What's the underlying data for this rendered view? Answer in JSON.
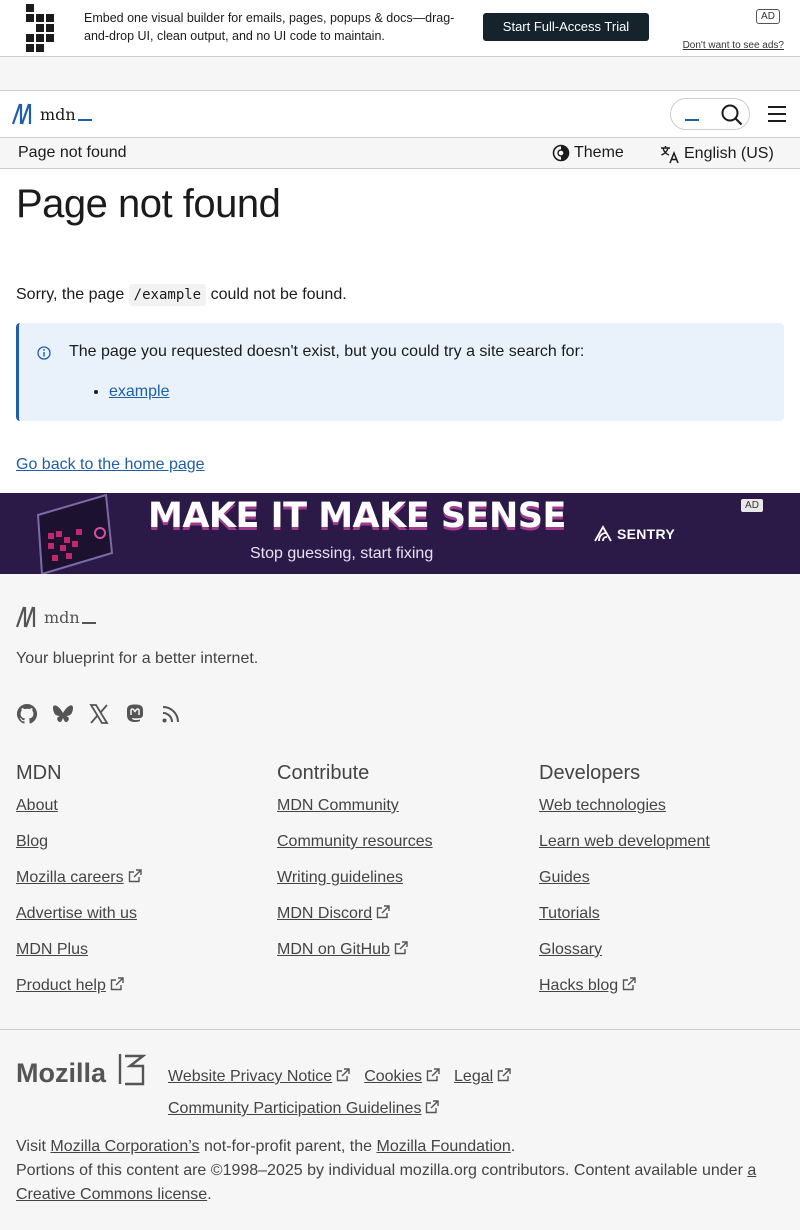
{
  "top_ad": {
    "copy": "Embed one visual builder for emails, pages, popups & docs—drag-and-drop UI, clean output, and no UI code to maintain.",
    "cta": "Start Full-Access Trial",
    "badge": "AD",
    "hide": "Don't want to see ads?"
  },
  "header": {
    "brand": "mdn",
    "menu_icon": "hamburger-menu-icon",
    "search_icon": "search-icon"
  },
  "breadcrumb": {
    "current": "Page not found",
    "theme_label": "Theme",
    "language_label": "English (US)"
  },
  "main": {
    "title": "Page not found",
    "sorry_prefix": "Sorry, the page",
    "path": "/example",
    "sorry_suffix": "could not be found.",
    "notice_text": "The page you requested doesn't exist, but you could try a site search for:",
    "suggestion": "example",
    "home_link": "Go back to the home page"
  },
  "sentry_ad": {
    "headline": "MAKE IT MAKE SENSE",
    "sub": "Stop guessing, start fixing",
    "brand": "SENTRY",
    "badge": "AD"
  },
  "footer": {
    "brand": "mdn",
    "tagline": "Your blueprint for a better internet.",
    "socials": [
      "github-icon",
      "bluesky-icon",
      "x-icon",
      "mastodon-icon",
      "rss-icon"
    ],
    "columns": [
      {
        "title": "MDN",
        "links": [
          {
            "label": "About",
            "external": false
          },
          {
            "label": "Blog",
            "external": false
          },
          {
            "label": "Mozilla careers",
            "external": true
          },
          {
            "label": "Advertise with us",
            "external": false
          },
          {
            "label": "MDN Plus",
            "external": false
          },
          {
            "label": "Product help",
            "external": true
          }
        ]
      },
      {
        "title": "Contribute",
        "links": [
          {
            "label": "MDN Community",
            "external": false
          },
          {
            "label": "Community resources",
            "external": false
          },
          {
            "label": "Writing guidelines",
            "external": false
          },
          {
            "label": "MDN Discord",
            "external": true
          },
          {
            "label": "MDN on GitHub",
            "external": true
          }
        ]
      },
      {
        "title": "Developers",
        "links": [
          {
            "label": "Web technologies",
            "external": false
          },
          {
            "label": "Learn web development",
            "external": false
          },
          {
            "label": "Guides",
            "external": false
          },
          {
            "label": "Tutorials",
            "external": false
          },
          {
            "label": "Glossary",
            "external": false
          },
          {
            "label": "Hacks blog",
            "external": true
          }
        ]
      }
    ],
    "mozilla_logo": "Mozilla",
    "legal_links": [
      "Website Privacy Notice",
      "Cookies",
      "Legal",
      "Community Participation Guidelines"
    ],
    "legal": {
      "visit": "Visit",
      "moz_corp": "Mozilla Corporation’s",
      "parent": "not-for-profit parent, the",
      "moz_foundation": "Mozilla Foundation",
      "period": ".",
      "portions": "Portions of this content are ©1998–2025 by individual mozilla.org contributors. Content available under",
      "cc_link": "a Creative Commons license",
      "end": "."
    }
  }
}
